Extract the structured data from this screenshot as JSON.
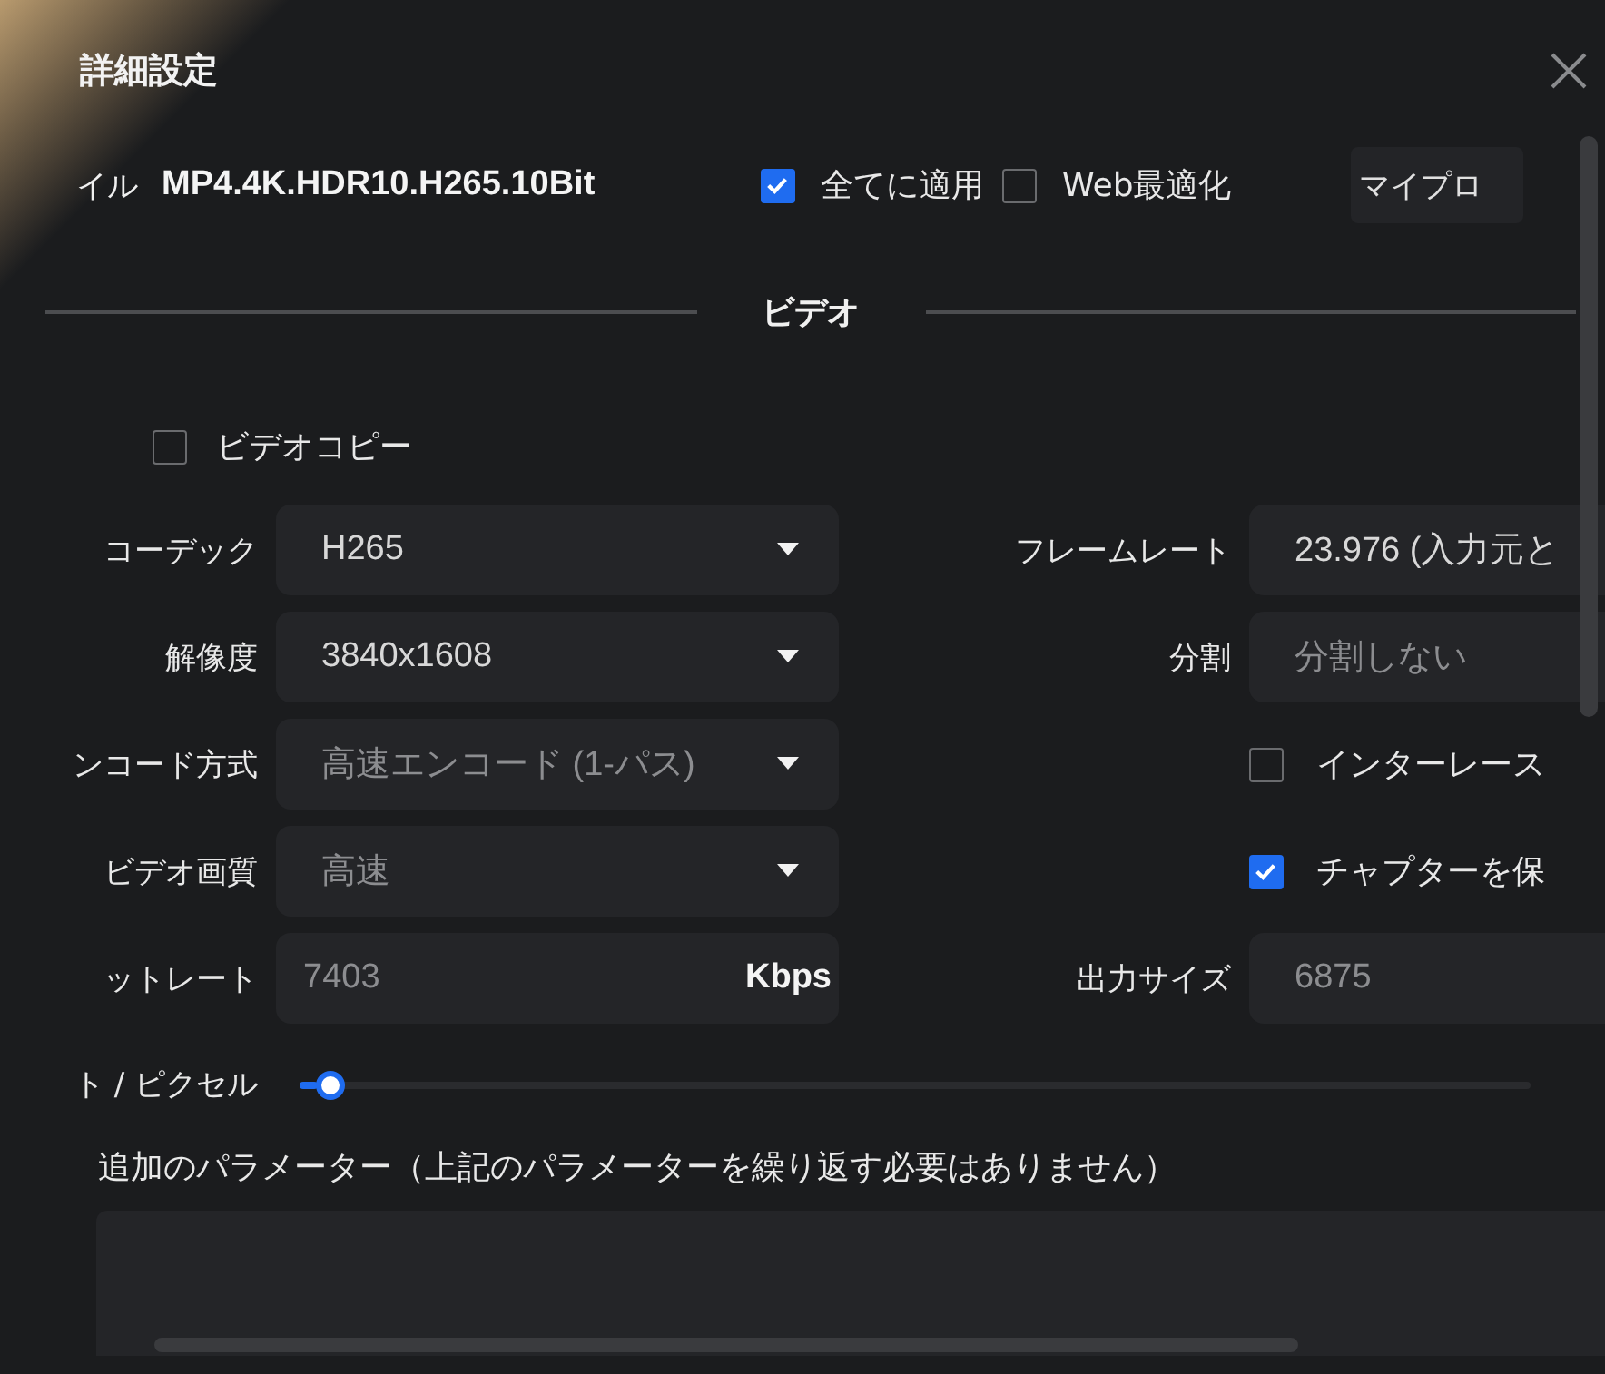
{
  "dialog": {
    "title": "詳細設定"
  },
  "profile": {
    "label": "イル",
    "value": "MP4.4K.HDR10.H265.10Bit"
  },
  "options": [
    {
      "label": "全てに適用",
      "checked": true
    },
    {
      "label": "Web最適化",
      "checked": false
    }
  ],
  "profile_button": {
    "label": "マイプロ"
  },
  "section": {
    "title": "ビデオ"
  },
  "video_copy": {
    "label": "ビデオコピー",
    "checked": false
  },
  "rows": [
    {
      "left": {
        "kind": "select",
        "label": "コーデック",
        "value": "H265",
        "disabled": false
      },
      "right": {
        "kind": "display",
        "label": "フレームレート",
        "value": "23.976 (入力元と",
        "disabled": false
      }
    },
    {
      "left": {
        "kind": "select",
        "label": "解像度",
        "value": "3840x1608",
        "disabled": false
      },
      "right": {
        "kind": "display",
        "label": "分割",
        "value": "分割しない",
        "disabled": true
      }
    },
    {
      "left": {
        "kind": "select",
        "label": "ンコード方式",
        "value": "高速エンコード (1-パス)",
        "disabled": true
      },
      "right": {
        "kind": "checkbox",
        "label": "インターレース",
        "checked": false
      }
    },
    {
      "left": {
        "kind": "select",
        "label": "ビデオ画質",
        "value": "高速",
        "disabled": true
      },
      "right": {
        "kind": "checkbox",
        "label": "チャプターを保",
        "checked": true
      }
    },
    {
      "left": {
        "kind": "input",
        "label": "ットレート",
        "value": "7403",
        "unit": "Kbps",
        "disabled": true
      },
      "right": {
        "kind": "display",
        "label": "出力サイズ",
        "value": "6875",
        "disabled": true
      }
    }
  ],
  "slider": {
    "label": "ト / ピクセル",
    "level": 0.015
  },
  "extra_params": {
    "label": "追加のパラメーター（上記のパラメーターを繰り返す必要はありません）"
  }
}
